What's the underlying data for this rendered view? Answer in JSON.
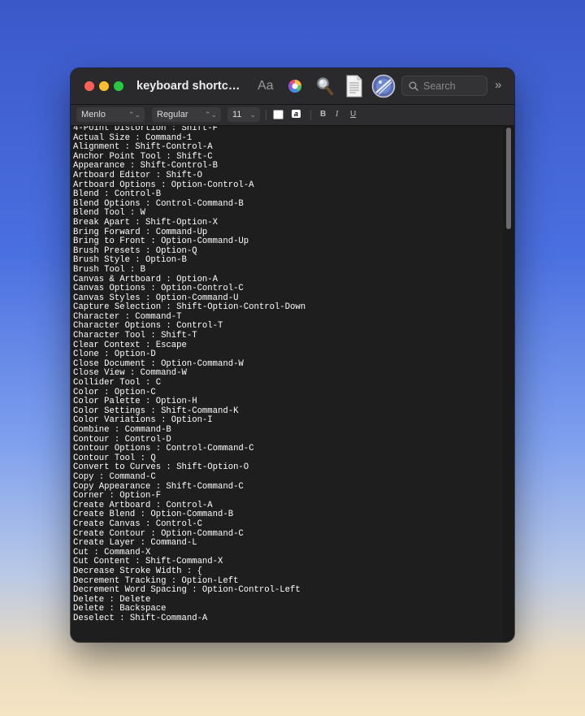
{
  "window": {
    "title": "keyboard shortcut..."
  },
  "toolbar": {
    "font_panel_label": "Aa",
    "search": {
      "placeholder": "Search",
      "value": ""
    },
    "overflow_label": "»"
  },
  "format_bar": {
    "font_family": "Menlo",
    "font_style": "Regular",
    "font_size": "11",
    "highlight_label": "a",
    "bold_label": "B",
    "italic_label": "I",
    "underline_label": "U"
  },
  "colors": {
    "close": "#fe5f57",
    "minimize": "#febc2e",
    "zoom": "#28c840",
    "text": "#ffffff",
    "background": "#1e1e1e"
  },
  "document": {
    "lines": [
      "4-Point Distortion : Shift-F",
      "Actual Size : Command-1",
      "Alignment : Shift-Control-A",
      "Anchor Point Tool : Shift-C",
      "Appearance : Shift-Control-B",
      "Artboard Editor : Shift-O",
      "Artboard Options : Option-Control-A",
      "Blend : Control-B",
      "Blend Options : Control-Command-B",
      "Blend Tool : W",
      "Break Apart : Shift-Option-X",
      "Bring Forward : Command-Up",
      "Bring to Front : Option-Command-Up",
      "Brush Presets : Option-Q",
      "Brush Style : Option-B",
      "Brush Tool : B",
      "Canvas & Artboard : Option-A",
      "Canvas Options : Option-Control-C",
      "Canvas Styles : Option-Command-U",
      "Capture Selection : Shift-Option-Control-Down",
      "Character : Command-T",
      "Character Options : Control-T",
      "Character Tool : Shift-T",
      "Clear Context : Escape",
      "Clone : Option-D",
      "Close Document : Option-Command-W",
      "Close View : Command-W",
      "Collider Tool : C",
      "Color : Option-C",
      "Color Palette : Option-H",
      "Color Settings : Shift-Command-K",
      "Color Variations : Option-I",
      "Combine : Command-B",
      "Contour : Control-D",
      "Contour Options : Control-Command-C",
      "Contour Tool : Q",
      "Convert to Curves : Shift-Option-O",
      "Copy : Command-C",
      "Copy Appearance : Shift-Command-C",
      "Corner : Option-F",
      "Create Artboard : Control-A",
      "Create Blend : Option-Command-B",
      "Create Canvas : Control-C",
      "Create Contour : Option-Command-C",
      "Create Layer : Command-L",
      "Cut : Command-X",
      "Cut Content : Shift-Command-X",
      "Decrease Stroke Width : {",
      "Decrement Tracking : Option-Left",
      "Decrement Word Spacing : Option-Control-Left",
      "Delete : Delete",
      "Delete : Backspace",
      "Deselect : Shift-Command-A"
    ]
  }
}
